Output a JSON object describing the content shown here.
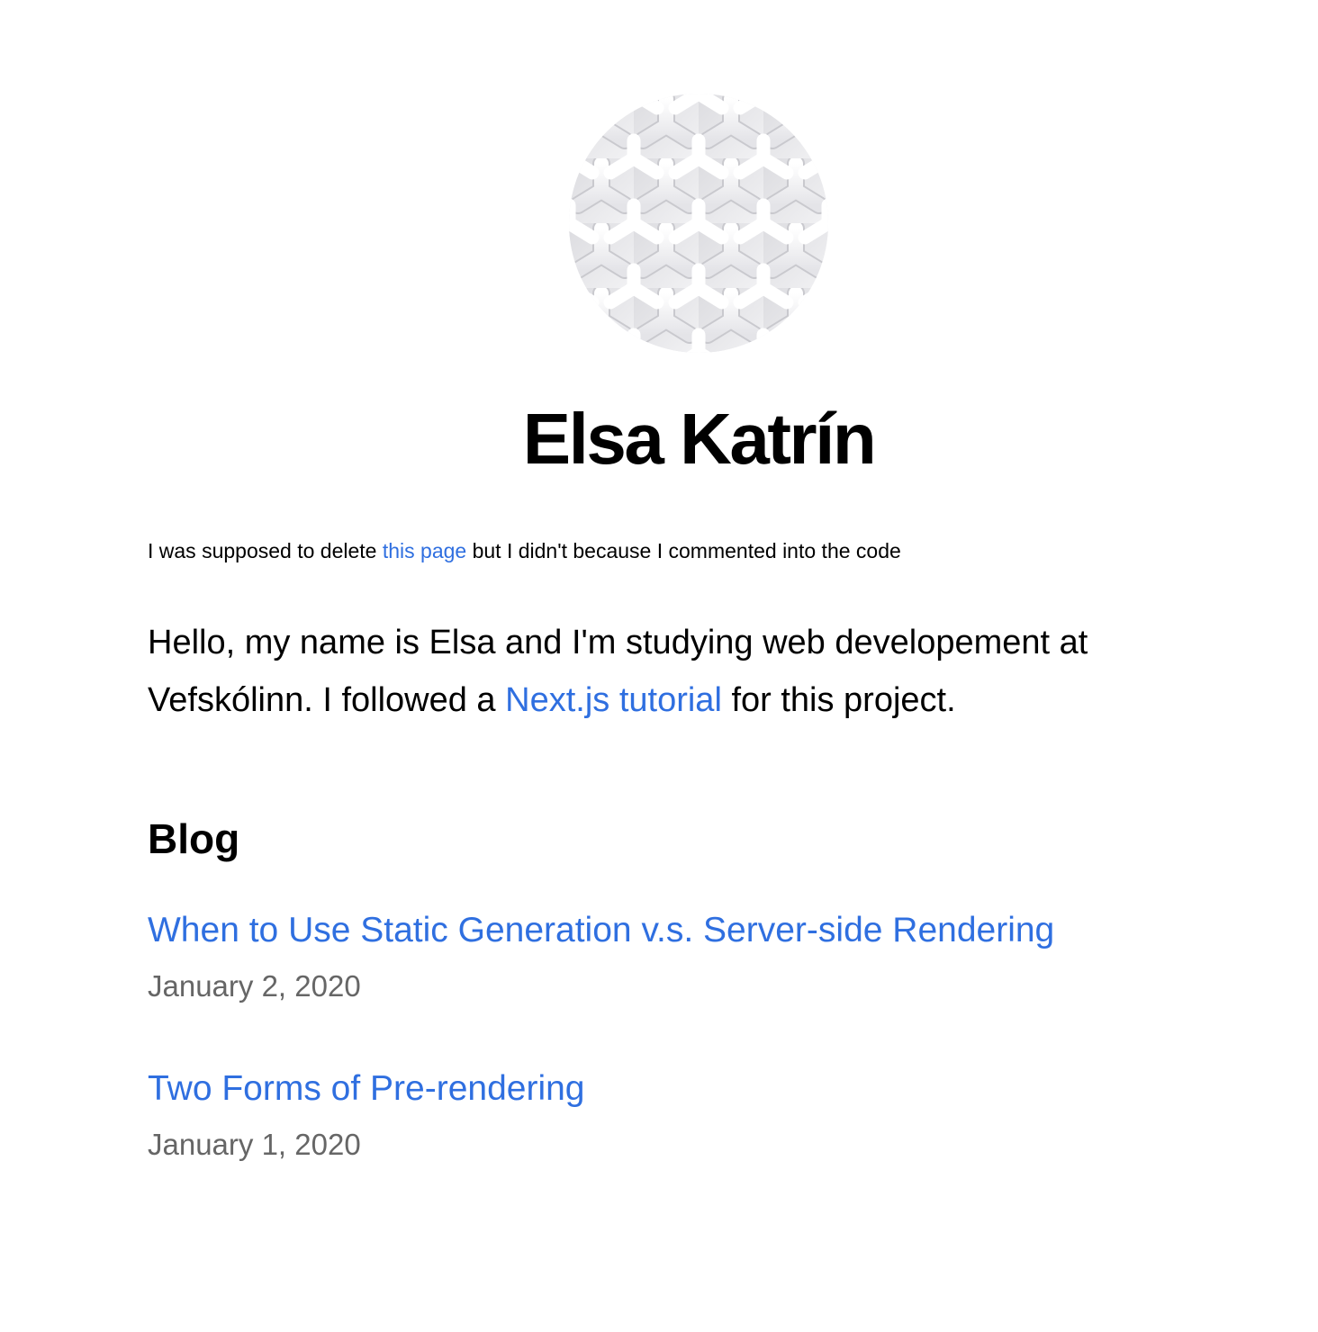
{
  "profile": {
    "name": "Elsa Katrín",
    "avatar_alt": "profile picture"
  },
  "note": {
    "before": "I was supposed to delete ",
    "link": "this page",
    "after": " but I didn't because I commented into the code"
  },
  "intro": {
    "before": "Hello, my name is Elsa and I'm studying web developement at Vefskólinn. I followed a ",
    "link": "Next.js tutorial",
    "after": " for this project."
  },
  "blog": {
    "heading": "Blog",
    "posts": [
      {
        "title": "When to Use Static Generation v.s. Server-side Rendering",
        "date": "January 2, 2020"
      },
      {
        "title": "Two Forms of Pre-rendering",
        "date": "January 1, 2020"
      }
    ]
  },
  "colors": {
    "link": "#2f6fe0",
    "date": "#666666",
    "text": "#000000",
    "background": "#ffffff"
  }
}
